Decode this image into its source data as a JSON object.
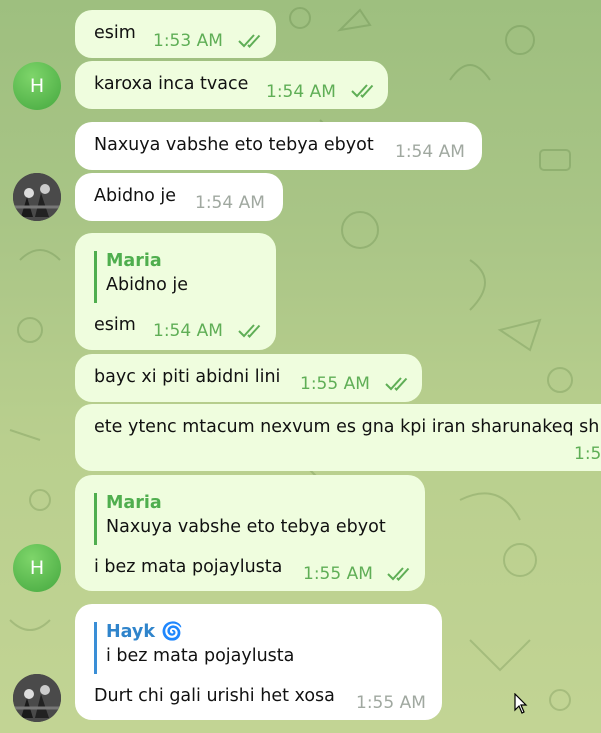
{
  "chat": {
    "messages": [
      {
        "text": "esim",
        "time": "1:53 AM"
      },
      {
        "text": "karoxa inca tvace",
        "time": "1:54 AM"
      },
      {
        "text": "Naxuya vabshe eto tebya ebyot",
        "time": "1:54 AM"
      },
      {
        "text": "Abidno je",
        "time": "1:54 AM"
      },
      {
        "quote_author": "Maria",
        "quote_text": "Abidno je",
        "text": "esim",
        "time": "1:54 AM"
      },
      {
        "text": "bayc xi piti abidni lini",
        "time": "1:55 AM"
      },
      {
        "text": "ete ytenc mtacum nexvum es gna kpi iran sharunakeq sh",
        "time": "1:5"
      },
      {
        "quote_author": "Maria",
        "quote_text": "Naxuya vabshe eto tebya ebyot",
        "text": "i bez mata pojaylusta",
        "time": "1:55 AM"
      },
      {
        "quote_author": "Hayk",
        "quote_author_emoji": "🌀",
        "quote_text": "i bez mata pojaylusta",
        "text": "Durt chi gali urishi het xosa",
        "time": "1:55 AM"
      }
    ],
    "avatar_initial": "H"
  },
  "colors": {
    "outgoing_bubble": "#effdde",
    "incoming_bubble": "#ffffff",
    "accent_green": "#4fae4e",
    "accent_blue": "#2f84cb"
  }
}
